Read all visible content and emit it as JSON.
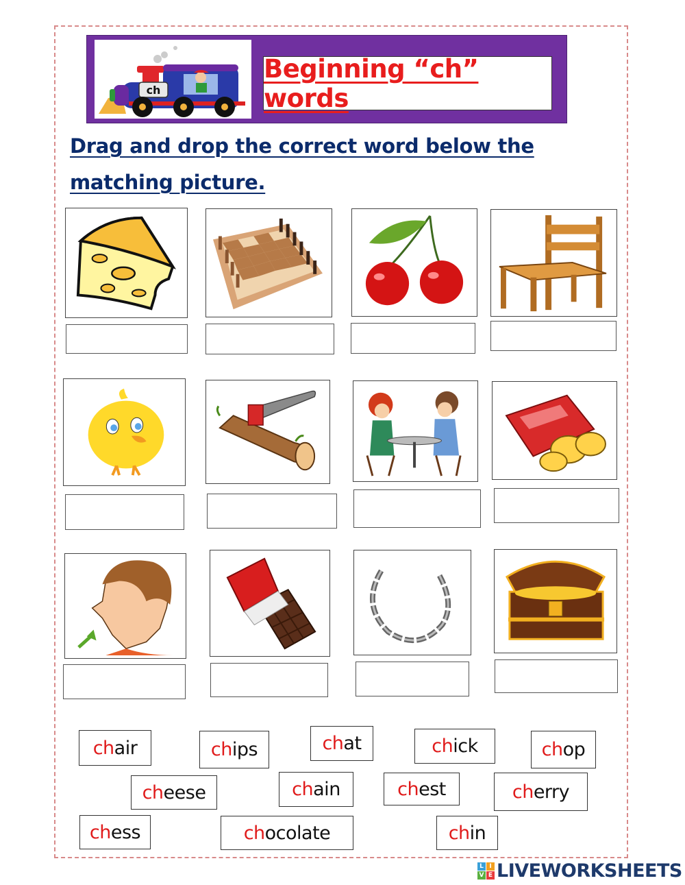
{
  "header": {
    "banner_title": "Beginning “ch” words",
    "train_badge": "ch",
    "banner_color": "#7030a0",
    "title_color": "#e81d1d"
  },
  "instructions": {
    "line1": "Drag and drop the correct word below the",
    "line2": "matching picture.",
    "color": "#0b2b6b"
  },
  "pictures": [
    {
      "name": "cheese"
    },
    {
      "name": "chess"
    },
    {
      "name": "cherry"
    },
    {
      "name": "chair"
    },
    {
      "name": "chick"
    },
    {
      "name": "chop"
    },
    {
      "name": "chat"
    },
    {
      "name": "chips"
    },
    {
      "name": "chin"
    },
    {
      "name": "chocolate"
    },
    {
      "name": "chain"
    },
    {
      "name": "chest"
    }
  ],
  "answer_boxes": [
    "",
    "",
    "",
    "",
    "",
    "",
    "",
    "",
    "",
    "",
    "",
    ""
  ],
  "word_bank": [
    {
      "prefix": "ch",
      "rest": "air"
    },
    {
      "prefix": "ch",
      "rest": "ips"
    },
    {
      "prefix": "ch",
      "rest": "at"
    },
    {
      "prefix": "ch",
      "rest": "ick"
    },
    {
      "prefix": "ch",
      "rest": "op"
    },
    {
      "prefix": "ch",
      "rest": "eese"
    },
    {
      "prefix": "ch",
      "rest": "ain"
    },
    {
      "prefix": "ch",
      "rest": "est"
    },
    {
      "prefix": "ch",
      "rest": "erry"
    },
    {
      "prefix": "ch",
      "rest": "ess"
    },
    {
      "prefix": "ch",
      "rest": "ocolate"
    },
    {
      "prefix": "ch",
      "rest": "in"
    }
  ],
  "footer": {
    "brand": "LIVEWORKSHEETS",
    "logo_letters": [
      "L",
      "I",
      "V",
      "E"
    ]
  }
}
